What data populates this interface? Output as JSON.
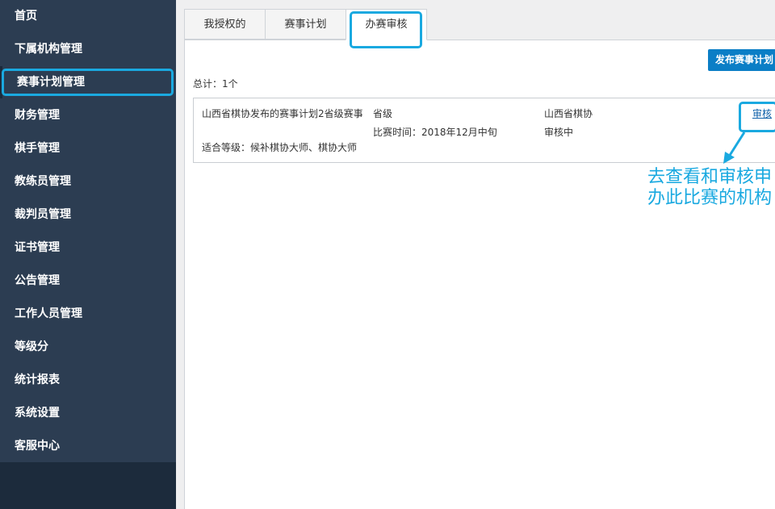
{
  "sidebar": {
    "items": [
      {
        "label": "首页"
      },
      {
        "label": "下属机构管理"
      },
      {
        "label": "赛事计划管理"
      },
      {
        "label": "财务管理"
      },
      {
        "label": "棋手管理"
      },
      {
        "label": "教练员管理"
      },
      {
        "label": "裁判员管理"
      },
      {
        "label": "证书管理"
      },
      {
        "label": "公告管理"
      },
      {
        "label": "工作人员管理"
      },
      {
        "label": "等级分"
      },
      {
        "label": "统计报表"
      },
      {
        "label": "系统设置"
      },
      {
        "label": "客服中心"
      }
    ],
    "active_index": 2
  },
  "tabs": [
    {
      "label": "我授权的"
    },
    {
      "label": "赛事计划"
    },
    {
      "label": "办赛审核"
    }
  ],
  "active_tab": 2,
  "toolbar": {
    "publish_label": "发布赛事计划"
  },
  "summary": {
    "total": "总计：1个"
  },
  "record": {
    "title": "山西省棋协发布的赛事计划2省级赛事",
    "level": "适合等级：候补棋协大师、棋协大师",
    "scope": "省级",
    "match_time": "比赛时间：2018年12月中旬",
    "org": "山西省棋协",
    "status": "审核中",
    "action_label": "审核"
  },
  "annotation": {
    "text": "去查看和审核申办此比赛的机构"
  },
  "colors": {
    "sidebar": "#2c3d52",
    "sidebar_bottom": "#1c2b3c",
    "accent": "#1aa9e0",
    "primary_button": "#0b7ec6",
    "link": "#0b5ea8"
  }
}
